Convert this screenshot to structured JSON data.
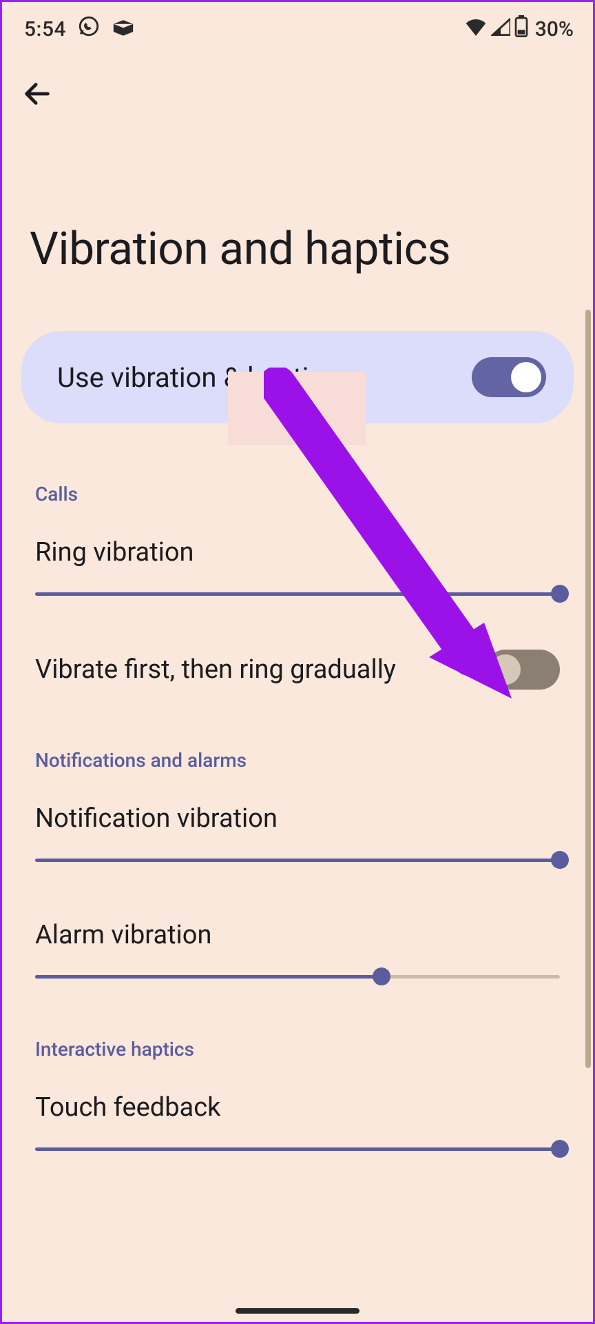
{
  "status": {
    "time": "5:54",
    "battery_text": "30%"
  },
  "header": {
    "title": "Vibration and haptics"
  },
  "main_toggle": {
    "label": "Use vibration & haptics",
    "enabled": true
  },
  "sections": {
    "calls": {
      "header": "Calls",
      "ring_vibration": {
        "label": "Ring vibration",
        "value": 100
      },
      "vibrate_first": {
        "label": "Vibrate first, then ring gradually",
        "enabled": false
      }
    },
    "notifications": {
      "header": "Notifications and alarms",
      "notification_vibration": {
        "label": "Notification vibration",
        "value": 100
      },
      "alarm_vibration": {
        "label": "Alarm vibration",
        "value": 66
      }
    },
    "interactive": {
      "header": "Interactive haptics",
      "touch_feedback": {
        "label": "Touch feedback",
        "value": 100
      }
    }
  }
}
